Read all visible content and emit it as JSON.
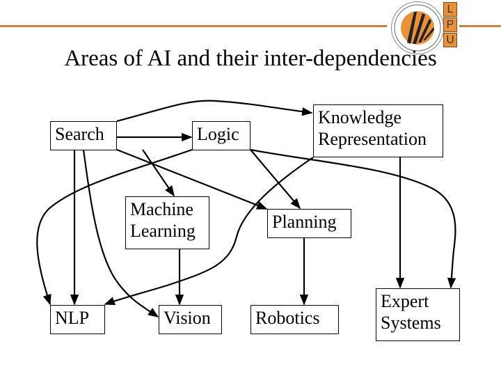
{
  "header": {
    "accent_color": "#c8813a",
    "logo": {
      "name": "lpu-emblem",
      "letters": [
        "L",
        "P",
        "U"
      ]
    }
  },
  "title": "Areas of AI and their inter-dependencies",
  "diagram": {
    "nodes": {
      "search": "Search",
      "logic": "Logic",
      "kr": "Knowledge\nRepresentation",
      "ml": "Machine\nLearning",
      "planning": "Planning",
      "nlp": "NLP",
      "vision": "Vision",
      "robotics": "Robotics",
      "expert": "Expert\nSystems"
    },
    "edges": [
      [
        "Search",
        "Logic"
      ],
      [
        "Search",
        "Knowledge Representation"
      ],
      [
        "Search",
        "Machine Learning"
      ],
      [
        "Search",
        "Planning"
      ],
      [
        "Search",
        "NLP"
      ],
      [
        "Search",
        "Vision"
      ],
      [
        "Logic",
        "NLP"
      ],
      [
        "Logic",
        "Planning"
      ],
      [
        "Logic",
        "Expert Systems"
      ],
      [
        "Knowledge Representation",
        "NLP"
      ],
      [
        "Knowledge Representation",
        "Expert Systems"
      ],
      [
        "Machine Learning",
        "Vision"
      ],
      [
        "Planning",
        "Robotics"
      ]
    ]
  }
}
